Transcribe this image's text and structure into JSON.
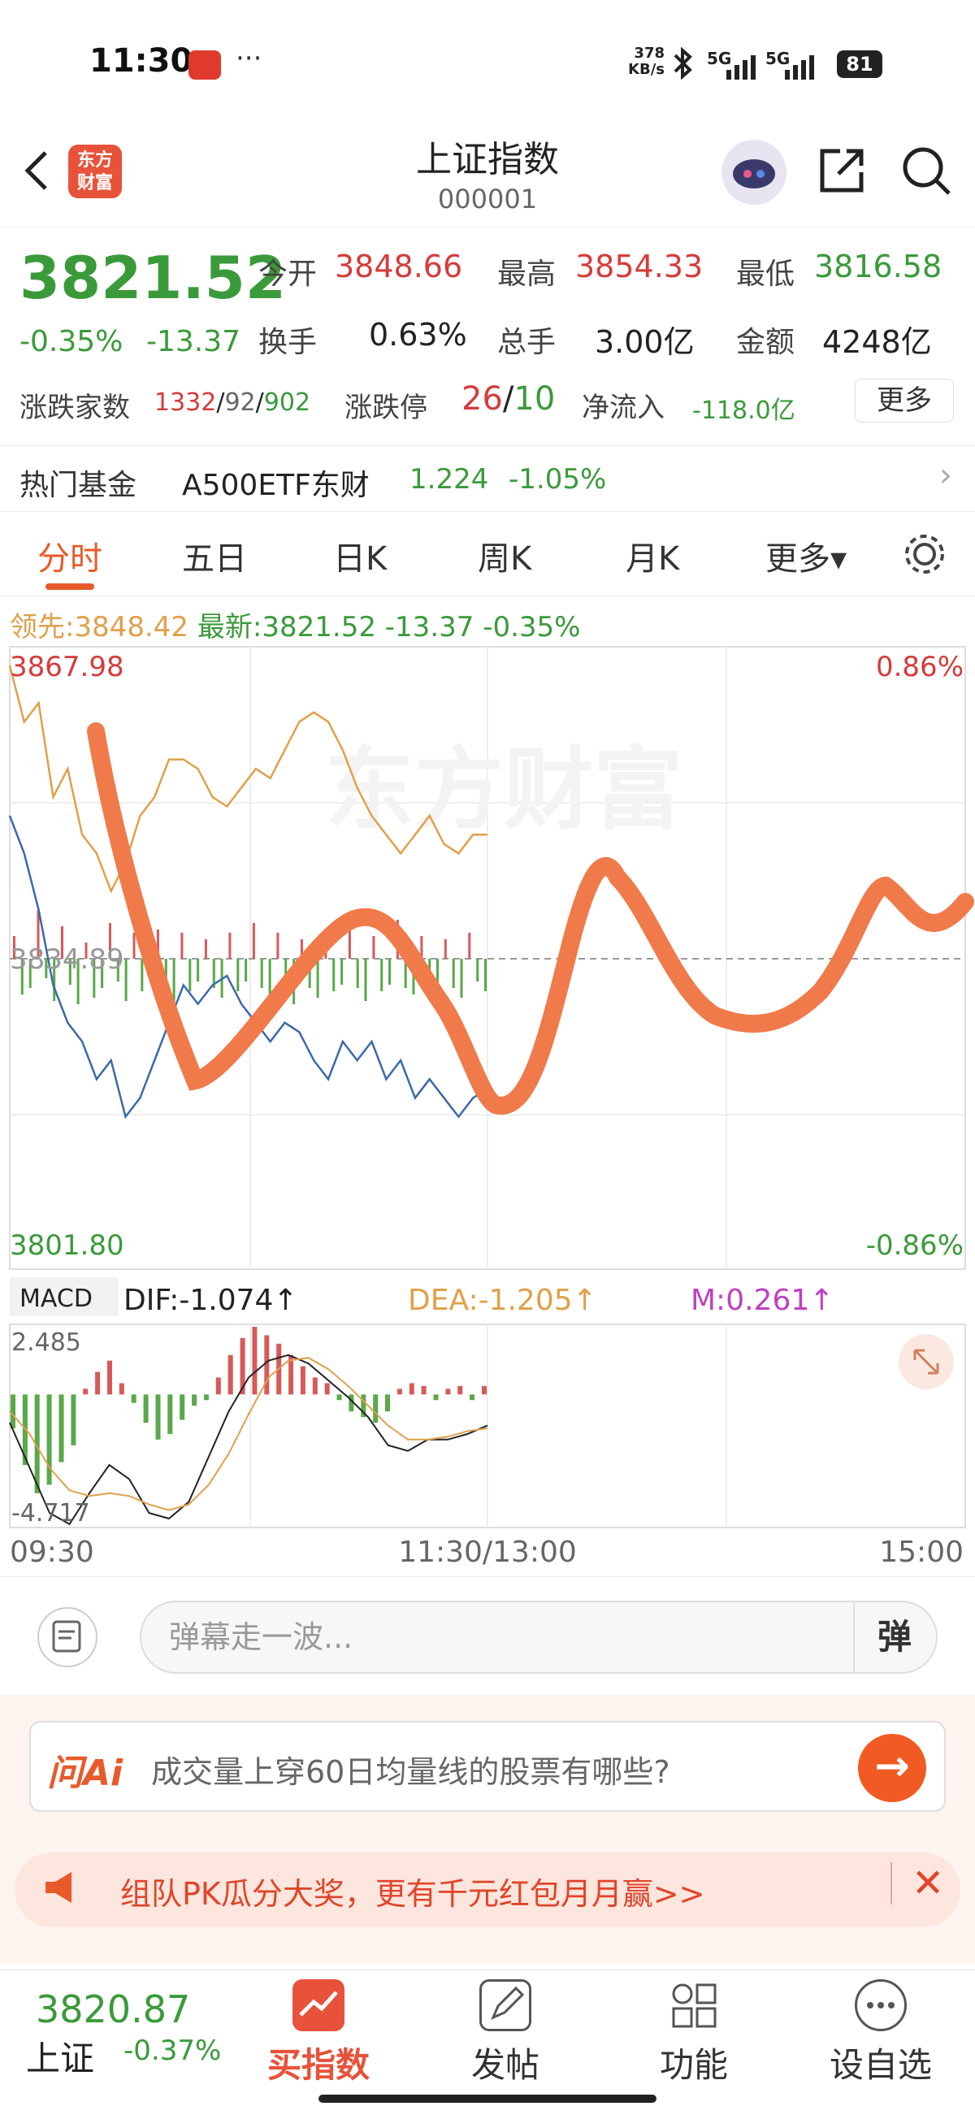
{
  "status": {
    "time": "11:30",
    "net_speed_value": "378",
    "net_speed_unit": "KB/s",
    "signal1": "5G",
    "signal2": "5G",
    "battery": "81",
    "dots": "···"
  },
  "header": {
    "title": "上证指数",
    "code": "000001",
    "logo_line1": "东方",
    "logo_line2": "财富"
  },
  "quote": {
    "price": "3821.52",
    "change_pct": "-0.35%",
    "change": "-13.37",
    "open_label": "今开",
    "open": "3848.66",
    "high_label": "最高",
    "high": "3854.33",
    "low_label": "最低",
    "low": "3816.58",
    "turnover_label": "换手",
    "turnover": "0.63%",
    "volume_label": "总手",
    "volume": "3.00亿",
    "amount_label": "金额",
    "amount": "4248亿",
    "breadth_label": "涨跌家数",
    "breadth_up": "1332",
    "breadth_sep1": "/",
    "breadth_flat": "92",
    "breadth_sep2": "/",
    "breadth_down": "902",
    "limit_label": "涨跌停",
    "limit_up": "26",
    "limit_sep": "/",
    "limit_down": "10",
    "inflow_label": "净流入",
    "inflow": "-118.0亿",
    "more": "更多"
  },
  "fund": {
    "label": "热门基金",
    "name": "A500ETF东财",
    "price": "1.224",
    "pct": "-1.05%",
    "chevron": "›"
  },
  "tabs": [
    {
      "label": "分时"
    },
    {
      "label": "五日"
    },
    {
      "label": "日K"
    },
    {
      "label": "周K"
    },
    {
      "label": "月K"
    },
    {
      "label": "更多▾"
    }
  ],
  "infoline": {
    "lead_label": "领先:",
    "lead": "3848.42",
    "latest_label": "最新:",
    "latest": "3821.52",
    "chg": "-13.37",
    "pct": "-0.35%"
  },
  "chart_data": [
    {
      "type": "line",
      "ylim": [
        3801.8,
        3867.98
      ],
      "yticks": {
        "top": "3867.98",
        "mid": "3834.89",
        "bottom": "3801.80",
        "top_pct": "0.86%",
        "bottom_pct": "-0.86%"
      },
      "x_labels": [
        "09:30",
        "11:30/13:00",
        "15:00"
      ],
      "watermark": "东方财富",
      "series": [
        {
          "color": "#e0a04a",
          "values": [
            3866,
            3860,
            3862,
            3852,
            3855,
            3848,
            3846,
            3842,
            3845,
            3850,
            3852,
            3856,
            3856,
            3855,
            3852,
            3851,
            3853,
            3855,
            3854,
            3857,
            3860,
            3861,
            3860,
            3857,
            3853,
            3850,
            3848,
            3846,
            3848,
            3850,
            3847,
            3846,
            3848,
            3848
          ]
        },
        {
          "color": "#3a6aa8",
          "values": [
            3850,
            3846,
            3840,
            3832,
            3828,
            3826,
            3822,
            3824,
            3818,
            3820,
            3824,
            3828,
            3832,
            3830,
            3832,
            3833,
            3830,
            3828,
            3826,
            3828,
            3827,
            3824,
            3822,
            3826,
            3824,
            3826,
            3822,
            3824,
            3820,
            3822,
            3820,
            3818,
            3820,
            3821
          ]
        }
      ],
      "volume": [
        14,
        22,
        18,
        30,
        12,
        26,
        20,
        16,
        28,
        10,
        24,
        18,
        22,
        14,
        26,
        16,
        20,
        12,
        18,
        22,
        30,
        16,
        20,
        14,
        12,
        18,
        24,
        16,
        20,
        14,
        22,
        18,
        26,
        16,
        20,
        28,
        12,
        18,
        24,
        14,
        20,
        16,
        22,
        18,
        26,
        14,
        20,
        16,
        24,
        18,
        22,
        14,
        16,
        20,
        12,
        18,
        24,
        16,
        14,
        20
      ]
    },
    {
      "type": "bar",
      "label": "MACD",
      "dif_label": "DIF:-1.074↑",
      "dea_label": "DEA:-1.205↑",
      "m_label": "M:0.261↑",
      "ylim": [
        -4.717,
        2.485
      ],
      "yticks": {
        "top": "2.485",
        "bottom": "-4.717"
      },
      "values": [
        -1.2,
        -2.5,
        -3.5,
        -3.2,
        -2.4,
        -1.8,
        0.2,
        0.8,
        1.2,
        0.4,
        -0.3,
        -1.0,
        -1.6,
        -1.4,
        -0.9,
        -0.4,
        -0.2,
        0.6,
        1.4,
        2.0,
        2.4,
        2.1,
        1.8,
        1.4,
        1.0,
        0.6,
        0.4,
        -0.2,
        -0.6,
        -0.8,
        -1.0,
        -0.6,
        0.2,
        0.4,
        0.3,
        -0.2,
        0.2,
        0.3,
        -0.2,
        0.3
      ],
      "dif": [
        -1.0,
        -2.6,
        -4.2,
        -4.6,
        -3.5,
        -2.5,
        -3.0,
        -4.2,
        -4.4,
        -3.8,
        -2.2,
        -0.6,
        0.6,
        1.2,
        1.4,
        1.1,
        0.5,
        -0.1,
        -0.8,
        -1.8,
        -2.0,
        -1.6,
        -1.6,
        -1.4,
        -1.1
      ],
      "dea": [
        -0.6,
        -1.4,
        -2.6,
        -3.4,
        -3.6,
        -3.5,
        -3.6,
        -3.9,
        -4.1,
        -3.9,
        -3.2,
        -2.1,
        -0.7,
        0.6,
        1.2,
        1.3,
        0.9,
        0.3,
        -0.4,
        -1.1,
        -1.6,
        -1.6,
        -1.5,
        -1.3,
        -1.2
      ]
    }
  ],
  "danmu": {
    "placeholder": "弹幕走一波...",
    "button": "弹"
  },
  "ai": {
    "logo": "问Ai",
    "question": "成交量上穿60日均量线的股票有哪些?",
    "go": "→"
  },
  "banner": {
    "text": "组队PK瓜分大奖，更有千元红包月月赢>>",
    "close": "✕"
  },
  "tabbar": {
    "index_value": "3820.87",
    "index_name": "上证",
    "index_pct": "-0.37%",
    "items": [
      {
        "label": "买指数"
      },
      {
        "label": "发帖"
      },
      {
        "label": "功能"
      },
      {
        "label": "设自选"
      }
    ]
  }
}
